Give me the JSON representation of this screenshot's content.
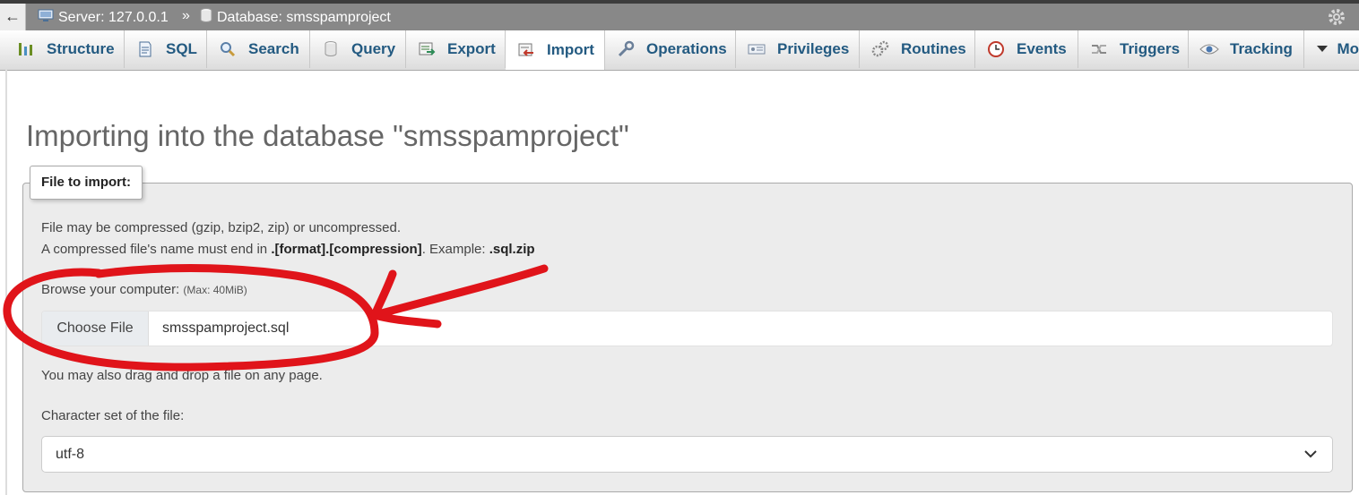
{
  "breadcrumb": {
    "back_glyph": "←",
    "server": "Server: 127.0.0.1",
    "separator": "»",
    "database": "Database: smsspamproject"
  },
  "tabs": [
    {
      "label": "Structure",
      "icon": "structure-icon",
      "active": false
    },
    {
      "label": "SQL",
      "icon": "sql-icon",
      "active": false
    },
    {
      "label": "Search",
      "icon": "search-icon",
      "active": false
    },
    {
      "label": "Query",
      "icon": "query-icon",
      "active": false
    },
    {
      "label": "Export",
      "icon": "export-icon",
      "active": false
    },
    {
      "label": "Import",
      "icon": "import-icon",
      "active": true
    },
    {
      "label": "Operations",
      "icon": "wrench-icon",
      "active": false
    },
    {
      "label": "Privileges",
      "icon": "privileges-icon",
      "active": false
    },
    {
      "label": "Routines",
      "icon": "routines-icon",
      "active": false
    },
    {
      "label": "Events",
      "icon": "clock-icon",
      "active": false
    },
    {
      "label": "Triggers",
      "icon": "triggers-icon",
      "active": false
    },
    {
      "label": "Tracking",
      "icon": "eye-icon",
      "active": false
    },
    {
      "label": "Mo",
      "icon": "chevron-down-icon",
      "active": false
    }
  ],
  "page": {
    "title": "Importing into the database \"smsspamproject\""
  },
  "import": {
    "legend": "File to import:",
    "line1": "File may be compressed (gzip, bzip2, zip) or uncompressed.",
    "line2_prefix": "A compressed file's name must end in ",
    "line2_format": ".[format].[compression]",
    "line2_mid": ". Example: ",
    "line2_example": ".sql.zip",
    "browse_label": "Browse your computer: ",
    "browse_max": "(Max: 40MiB)",
    "choose_button": "Choose File",
    "filename": "smsspamproject.sql",
    "drag_hint": "You may also drag and drop a file on any page.",
    "charset_label": "Character set of the file:",
    "charset_value": "utf-8"
  },
  "colors": {
    "tab_text": "#235a81",
    "annotation_red": "#e0141a",
    "crumb_bg": "#888888"
  }
}
